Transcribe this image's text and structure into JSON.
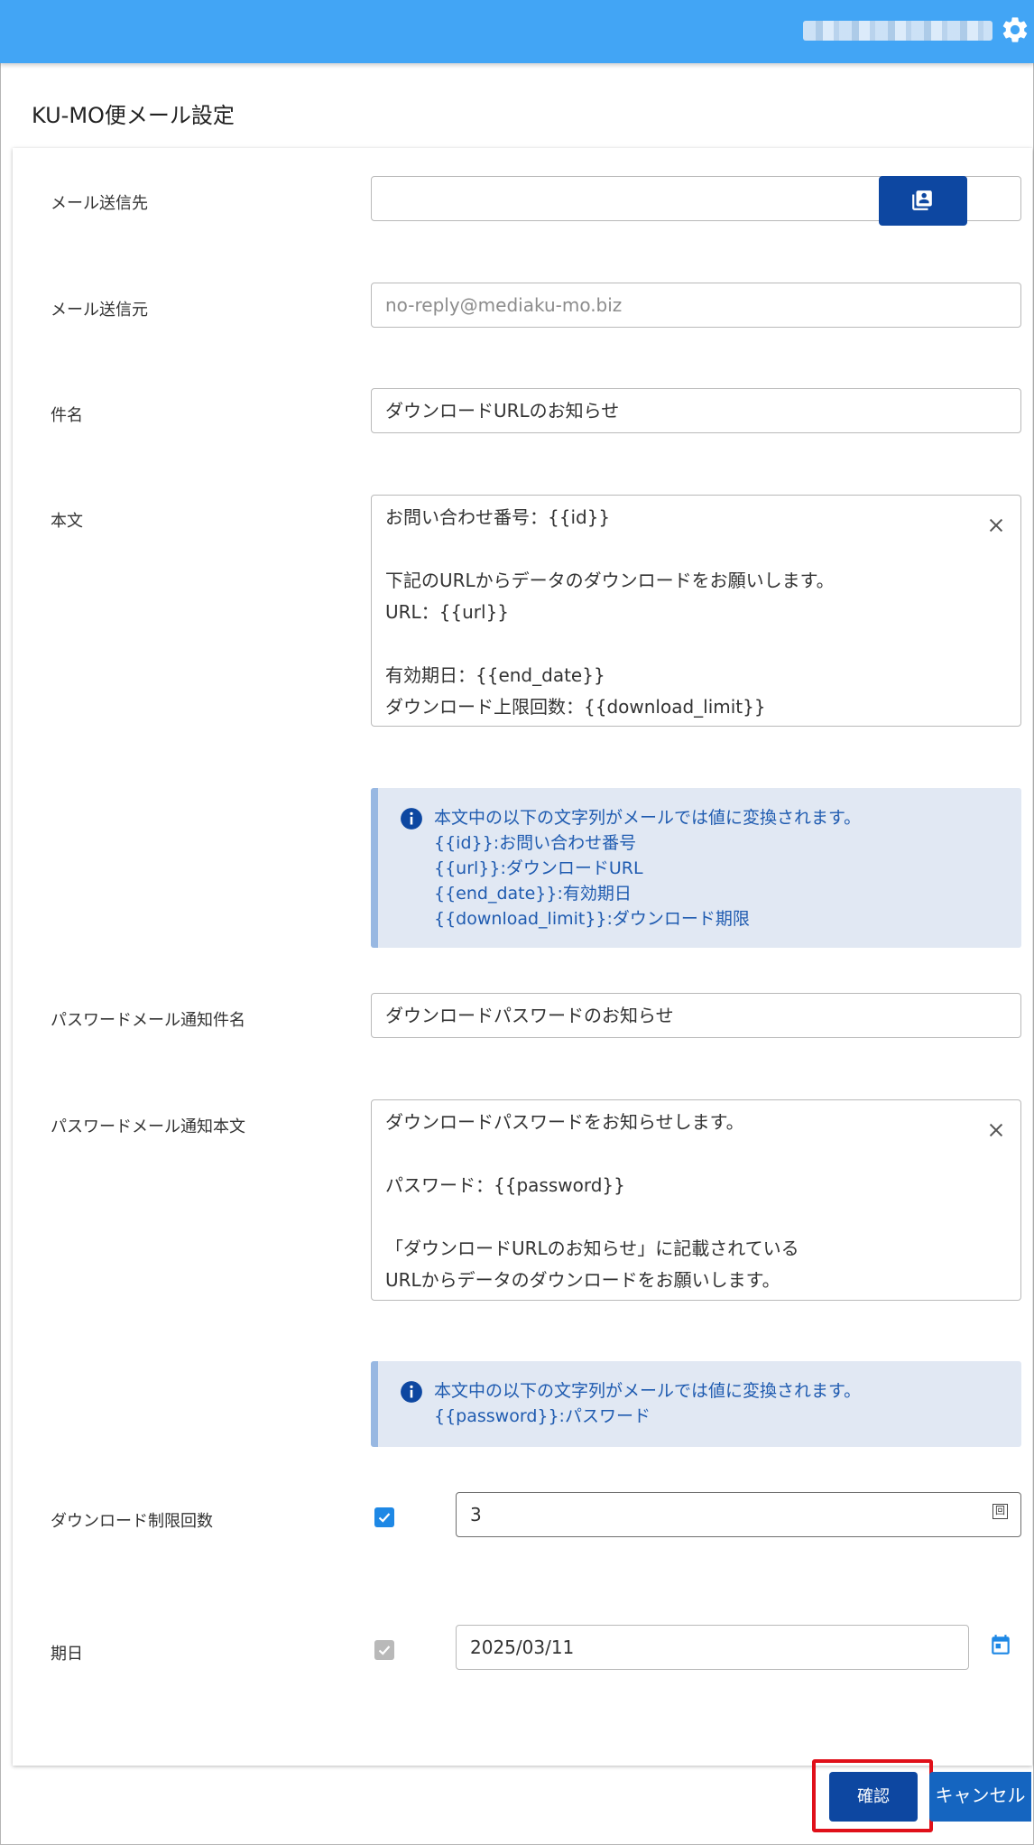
{
  "header": {
    "user_name": "",
    "settings_icon": "gear-icon",
    "bar_color": "#42a5f5"
  },
  "page_title": "KU-MO便メール設定",
  "fields": {
    "to": {
      "label": "メール送信先",
      "value": "",
      "address_book_icon": "contacts-icon"
    },
    "from": {
      "label": "メール送信元",
      "placeholder": "no-reply@mediaku-mo.biz"
    },
    "subject": {
      "label": "件名",
      "value": "ダウンロードURLのお知らせ"
    },
    "body": {
      "label": "本文",
      "lines": [
        "お問い合わせ番号：{{id}}",
        "",
        "下記のURLからデータのダウンロードをお願いします。",
        "URL：{{url}}",
        "",
        "有効期日：{{end_date}}",
        "ダウンロード上限回数：{{download_limit}}"
      ]
    },
    "body_info": [
      "本文中の以下の文字列がメールでは値に変換されます。",
      "{{id}}:お問い合わせ番号",
      "{{url}}:ダウンロードURL",
      "{{end_date}}:有効期日",
      "{{download_limit}}:ダウンロード期限"
    ],
    "pw_subject": {
      "label": "パスワードメール通知件名",
      "value": "ダウンロードパスワードのお知らせ"
    },
    "pw_body": {
      "label": "パスワードメール通知本文",
      "lines": [
        "ダウンロードパスワードをお知らせします。",
        "",
        "パスワード：{{password}}",
        "",
        "「ダウンロードURLのお知らせ」に記載されている",
        "URLからデータのダウンロードをお願いします。"
      ]
    },
    "pw_info": [
      "本文中の以下の文字列がメールでは値に変換されます。",
      "{{password}}:パスワード"
    ],
    "download_limit": {
      "label": "ダウンロード制限回数",
      "checked": true,
      "value": "3",
      "unit": "回"
    },
    "due_date": {
      "label": "期日",
      "checked": true,
      "value": "2025/03/11"
    }
  },
  "actions": {
    "confirm": "確認",
    "cancel": "キャンセル"
  },
  "colors": {
    "primary": "#0d47a1",
    "checkbox": "#1e88e5",
    "info_text": "#1f5bb0",
    "info_bg": "#e1e8f3",
    "highlight": "#e0101a"
  }
}
